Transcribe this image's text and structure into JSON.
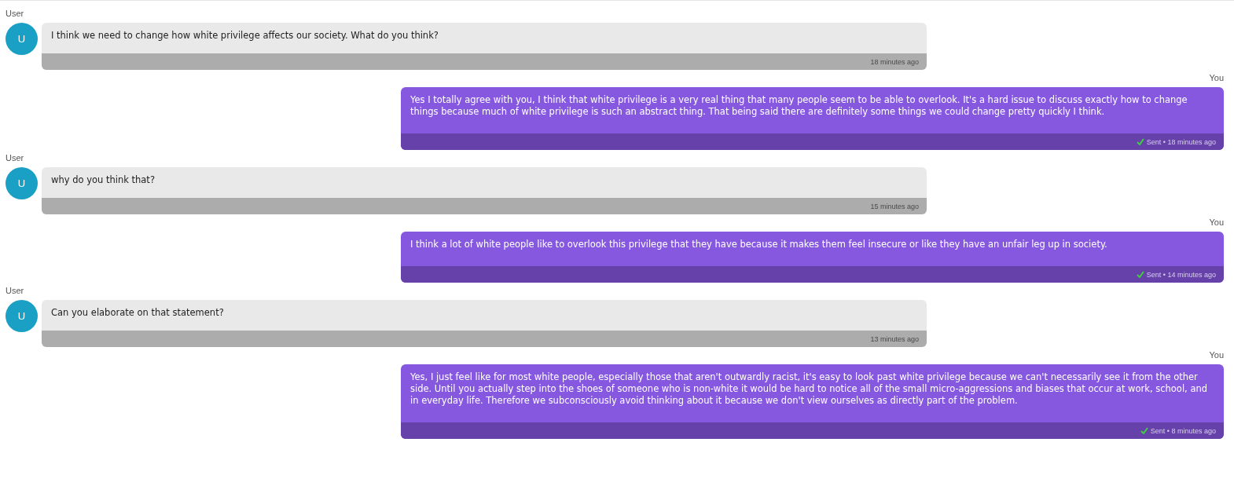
{
  "messages": [
    {
      "kind": "received",
      "sender": "User",
      "avatar": "U",
      "text": "I think we need to change how white privilege affects our society. What do you think?",
      "footer": "18 minutes ago"
    },
    {
      "kind": "sent",
      "sender": "You",
      "text": "Yes I totally agree with you, I think that white privilege is a very real thing that many people seem to be able to overlook. It's a hard issue to discuss exactly how to change things because much of white privilege is such an abstract thing. That being said there are definitely some things we could change pretty quickly I think.",
      "footer": "Sent • 18 minutes ago"
    },
    {
      "kind": "received",
      "sender": "User",
      "avatar": "U",
      "text": "why do you think that?",
      "footer": "15 minutes ago"
    },
    {
      "kind": "sent",
      "sender": "You",
      "text": "I think a lot of white people like to overlook this privilege that they have because it makes them feel insecure or like they have an unfair leg up in society.",
      "footer": "Sent • 14 minutes ago"
    },
    {
      "kind": "received",
      "sender": "User",
      "avatar": "U",
      "text": "Can you elaborate on that statement?",
      "footer": "13 minutes ago"
    },
    {
      "kind": "sent",
      "sender": "You",
      "text": "Yes, I just feel like for most white people, especially those that aren't outwardly racist, it's easy to look past white privilege because we can't necessarily see it from the other side. Until you actually step into the shoes of someone who is non-white it would be hard to notice all of the small micro-aggressions and biases that occur at work, school, and in everyday life. Therefore we subconsciously avoid thinking about it because we don't view ourselves as directly part of the problem.",
      "footer": "Sent • 8 minutes ago"
    }
  ]
}
